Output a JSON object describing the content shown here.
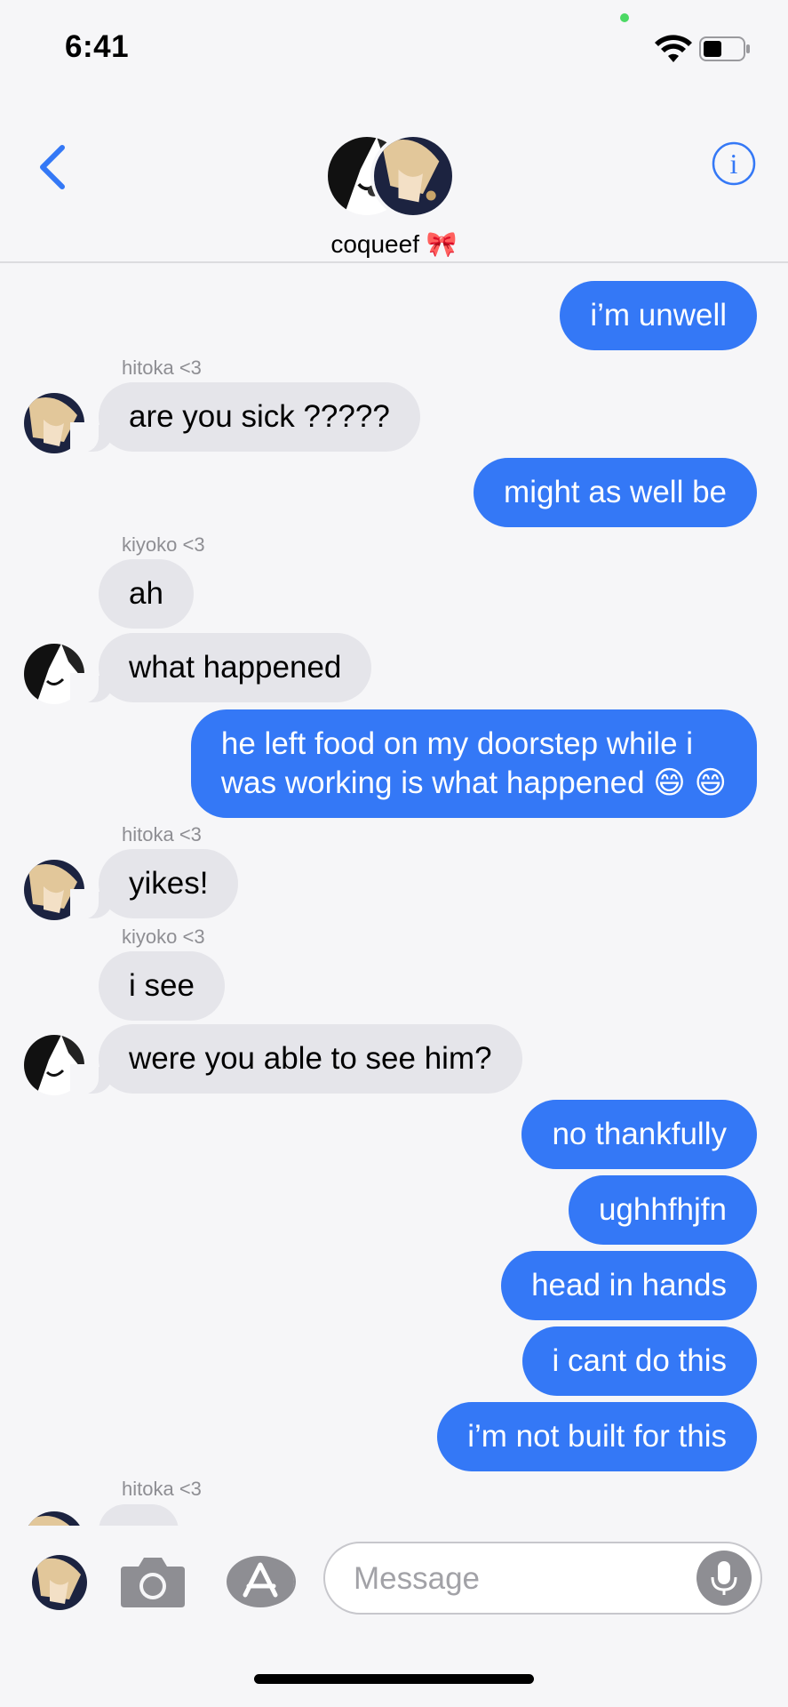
{
  "status_bar": {
    "time": "6:41"
  },
  "header": {
    "group_name": "coqueef 🎀"
  },
  "messages": [
    {
      "side": "out",
      "text": "i’m unwell"
    },
    {
      "side": "in",
      "sender": "hitoka <3",
      "text": "are you sick ?????"
    },
    {
      "side": "out",
      "text": "might as well be"
    },
    {
      "side": "in",
      "sender": "kiyoko <3",
      "text": "ah"
    },
    {
      "side": "in",
      "text": "what happened"
    },
    {
      "side": "out",
      "text_line1": "he left food on my doorstep while i",
      "text_line2": "was working is what happened 😄 😄"
    },
    {
      "side": "in",
      "sender": "hitoka <3",
      "text": "yikes!"
    },
    {
      "side": "in",
      "sender": "kiyoko <3",
      "text": "i see"
    },
    {
      "side": "in",
      "text": "were you able to see him?"
    },
    {
      "side": "out",
      "text": "no thankfully"
    },
    {
      "side": "out",
      "text": "ughhfhjfn"
    },
    {
      "side": "out",
      "text": "head in hands"
    },
    {
      "side": "out",
      "text": "i cant do this"
    },
    {
      "side": "out",
      "text": "i’m not built for this"
    },
    {
      "side": "in",
      "sender": "hitoka <3",
      "text": ""
    }
  ],
  "input": {
    "placeholder": "Message"
  },
  "colors": {
    "outgoing": "#3478f6",
    "incoming": "#e5e5ea",
    "accent": "#3478f6"
  },
  "icons": [
    "back-chevron-icon",
    "info-icon",
    "camera-icon",
    "app-store-icon",
    "microphone-icon",
    "wifi-icon",
    "battery-icon"
  ]
}
